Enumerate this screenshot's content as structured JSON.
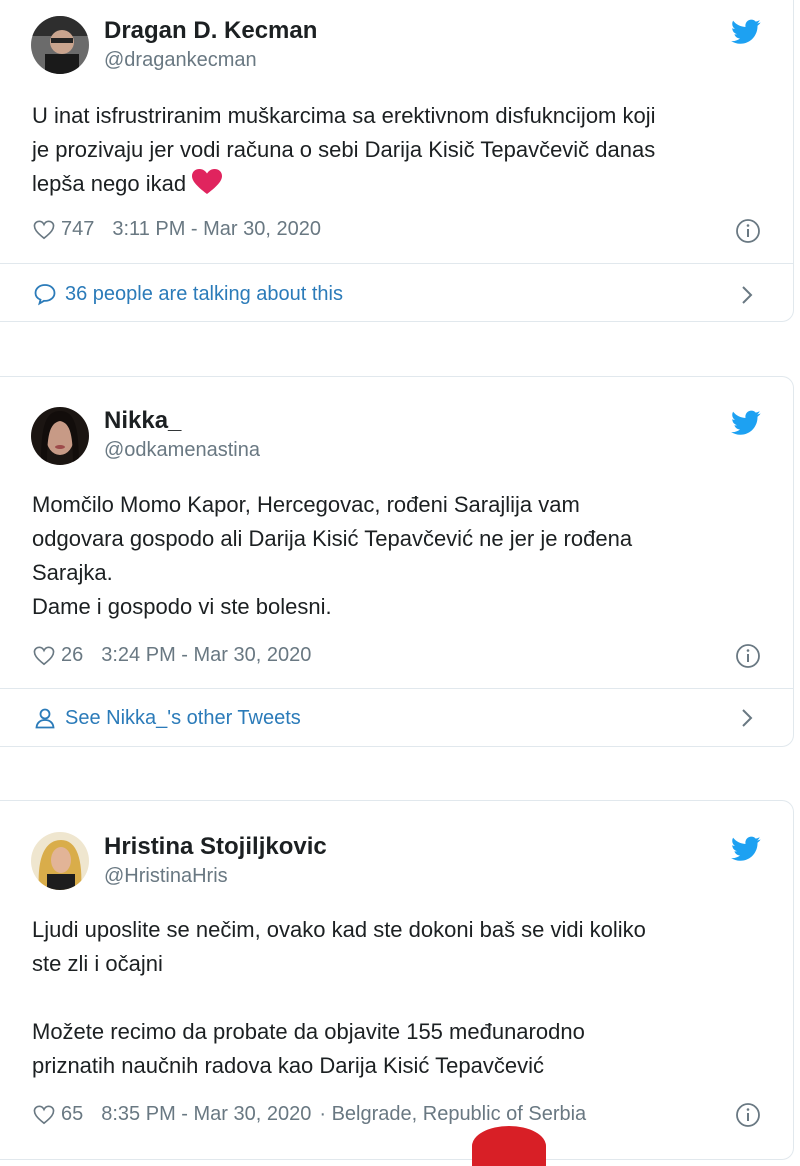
{
  "tweets": [
    {
      "name": "Dragan D. Kecman",
      "handle": "@dragankecman",
      "text_lines": [
        "U inat isfrustriranim muškarcima sa erektivnom disfukncijom koji",
        "je prozivaju jer vodi računa o sebi Darija Kisič Tepavčevič danas",
        "lepša nego ikad"
      ],
      "likes": "747",
      "datetime": "3:11 PM - Mar 30, 2020",
      "footer": "36 people are talking about this",
      "footer_icon": "speech-bubble-icon"
    },
    {
      "name": "Nikka_",
      "handle": "@odkamenastina",
      "text_lines": [
        "Momčilo Momo Kapor, Hercegovac, rođeni Sarajlija vam",
        "odgovara gospodo ali Darija Kisić Tepavčević ne jer je rođena",
        "Sarajka.",
        "Dame i gospodo vi ste bolesni."
      ],
      "likes": "26",
      "datetime": "3:24 PM - Mar 30, 2020",
      "footer": "See Nikka_'s other Tweets",
      "footer_icon": "person-icon"
    },
    {
      "name": "Hristina Stojiljkovic",
      "handle": "@HristinaHris",
      "text_lines": [
        "Ljudi uposlite se nečim, ovako kad ste dokoni baš se vidi koliko",
        "ste zli i očajni",
        "",
        "Možete recimo da probate da objavite 155 međunarodno",
        "priznatih naučnih radova kao Darija Kisić Tepavčević"
      ],
      "likes": "65",
      "datetime": "8:35 PM - Mar 30, 2020",
      "location": "· Belgrade, Republic of Serbia"
    }
  ],
  "colors": {
    "link": "#2b7bb9",
    "twitter_blue": "#1da1f2",
    "muted": "#697882",
    "heart_emoji": "#e0245e"
  }
}
